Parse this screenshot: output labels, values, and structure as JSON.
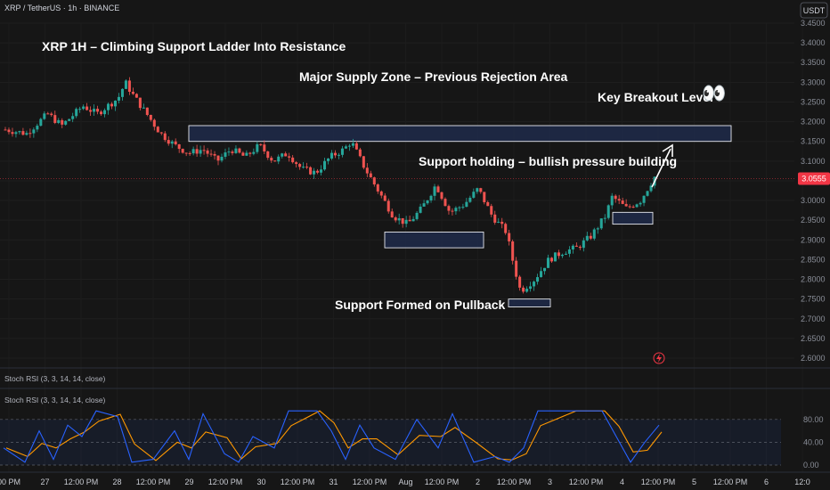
{
  "header": {
    "symbol_line": "XRP / TetherUS · 1h · BINANCE",
    "currency_badge": "USDT"
  },
  "price_axis": {
    "ticks": [
      "3.4500",
      "3.4000",
      "3.3500",
      "3.3000",
      "3.2500",
      "3.2000",
      "3.1500",
      "3.1000",
      "3.0500",
      "3.0000",
      "2.9500",
      "2.9000",
      "2.8500",
      "2.8000",
      "2.7500",
      "2.7000",
      "2.6500",
      "2.6000"
    ],
    "last_price": "3.0555"
  },
  "time_axis": {
    "ticks": [
      "00 PM",
      "27",
      "12:00 PM",
      "28",
      "12:00 PM",
      "29",
      "12:00 PM",
      "30",
      "12:00 PM",
      "31",
      "12:00 PM",
      "Aug",
      "12:00 PM",
      "2",
      "12:00 PM",
      "3",
      "12:00 PM",
      "4",
      "12:00 PM",
      "5",
      "12:00 PM",
      "6",
      "12:0"
    ]
  },
  "annotations": {
    "title": "XRP 1H – Climbing Support Ladder Into Resistance",
    "supply_zone": "Major Supply Zone – Previous Rejection Area",
    "breakout": "Key Breakout Level",
    "support_holding": "Support holding – bullish pressure building",
    "support_pullback": "Support Formed on Pullback",
    "emoji": "👀"
  },
  "indicator": {
    "divider_label": "Stoch RSI (3, 3, 14, 14, close)",
    "pane_label": "Stoch RSI (3, 3, 14, 14, close)",
    "ticks": [
      "80.00",
      "40.00",
      "0.00"
    ]
  },
  "colors": {
    "background": "#161616",
    "bull": "#26a69a",
    "bear": "#ef5350",
    "k_line": "#2962ff",
    "d_line": "#ff9800",
    "zone_fill": "#1e2a4a",
    "price_line": "#f23645"
  },
  "chart_data": {
    "type": "candlestick",
    "title": "XRP 1H – Climbing Support Ladder Into Resistance",
    "interval": "1h",
    "y_range": [
      2.58,
      3.47
    ],
    "price_path": [
      [
        0,
        3.18
      ],
      [
        3,
        3.17
      ],
      [
        6,
        3.22
      ],
      [
        8,
        3.19
      ],
      [
        11,
        3.24
      ],
      [
        13,
        3.22
      ],
      [
        16,
        3.26
      ],
      [
        17,
        3.3
      ],
      [
        18,
        3.27
      ],
      [
        20,
        3.22
      ],
      [
        22,
        3.17
      ],
      [
        24,
        3.14
      ],
      [
        26,
        3.12
      ],
      [
        28,
        3.13
      ],
      [
        30,
        3.1
      ],
      [
        32,
        3.13
      ],
      [
        34,
        3.11
      ],
      [
        36,
        3.14
      ],
      [
        38,
        3.1
      ],
      [
        40,
        3.12
      ],
      [
        42,
        3.08
      ],
      [
        44,
        3.07
      ],
      [
        46,
        3.11
      ],
      [
        48,
        3.13
      ],
      [
        49,
        3.15
      ],
      [
        51,
        3.08
      ],
      [
        53,
        3.02
      ],
      [
        55,
        2.96
      ],
      [
        57,
        2.94
      ],
      [
        59,
        2.98
      ],
      [
        61,
        3.04
      ],
      [
        63,
        2.97
      ],
      [
        65,
        2.99
      ],
      [
        67,
        3.03
      ],
      [
        69,
        2.96
      ],
      [
        71,
        2.92
      ],
      [
        72,
        2.84
      ],
      [
        73,
        2.77
      ],
      [
        75,
        2.8
      ],
      [
        77,
        2.85
      ],
      [
        79,
        2.87
      ],
      [
        81,
        2.88
      ],
      [
        83,
        2.91
      ],
      [
        85,
        2.96
      ],
      [
        86,
        3.01
      ],
      [
        88,
        2.98
      ],
      [
        90,
        3.0
      ],
      [
        92,
        3.06
      ]
    ],
    "zones": [
      {
        "label": "Major Supply Zone – Previous Rejection Area",
        "price_low": 3.15,
        "price_high": 3.19
      },
      {
        "label": "Support",
        "price_low": 2.88,
        "price_high": 2.92
      },
      {
        "label": "Support Formed on Pullback",
        "price_low": 2.73,
        "price_high": 2.75
      },
      {
        "label": "Support holding",
        "price_low": 2.94,
        "price_high": 2.97
      }
    ],
    "last_price": 3.0555,
    "stoch_rsi": {
      "params": "(3, 3, 14, 14, close)",
      "levels": [
        80,
        40,
        0
      ],
      "k_path": [
        [
          0,
          30
        ],
        [
          3,
          5
        ],
        [
          5,
          60
        ],
        [
          7,
          10
        ],
        [
          9,
          70
        ],
        [
          11,
          50
        ],
        [
          13,
          95
        ],
        [
          16,
          85
        ],
        [
          18,
          5
        ],
        [
          21,
          10
        ],
        [
          24,
          60
        ],
        [
          26,
          10
        ],
        [
          28,
          90
        ],
        [
          31,
          20
        ],
        [
          33,
          5
        ],
        [
          35,
          50
        ],
        [
          38,
          30
        ],
        [
          40,
          95
        ],
        [
          44,
          95
        ],
        [
          46,
          60
        ],
        [
          48,
          10
        ],
        [
          50,
          70
        ],
        [
          52,
          30
        ],
        [
          55,
          10
        ],
        [
          58,
          80
        ],
        [
          61,
          30
        ],
        [
          63,
          90
        ],
        [
          66,
          5
        ],
        [
          69,
          15
        ],
        [
          71,
          5
        ],
        [
          73,
          30
        ],
        [
          75,
          95
        ],
        [
          80,
          95
        ],
        [
          84,
          95
        ],
        [
          86,
          50
        ],
        [
          88,
          5
        ],
        [
          90,
          40
        ],
        [
          92,
          70
        ]
      ]
    }
  }
}
